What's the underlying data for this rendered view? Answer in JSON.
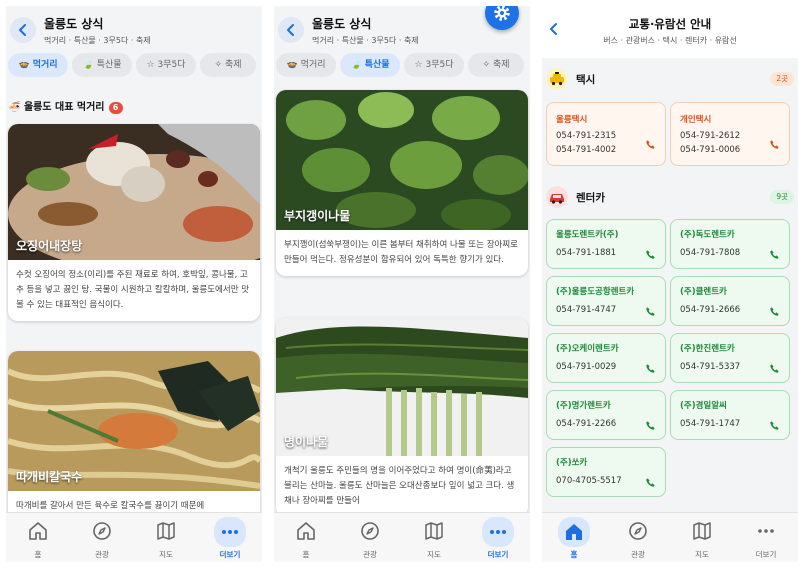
{
  "food": {
    "header": {
      "title": "울릉도 상식",
      "subtitle": "먹거리 · 특산물 · 3무5다 · 축제"
    },
    "tabs": [
      {
        "label": "먹거리"
      },
      {
        "label": "특산물"
      },
      {
        "label": "3무5다"
      },
      {
        "label": "축제"
      }
    ],
    "section": {
      "title": "울릉도 대표 먹거리",
      "count": "6"
    },
    "cards": [
      {
        "title": "오징어내장탕",
        "desc": "수컷 오징어의 정소(이리)를 주된 재료로 하여, 호박잎, 콩나물, 고추 등을 넣고 끓인 탕. 국물이 시원하고 칼칼하며, 울릉도에서만 맛볼 수 있는 대표적인 음식이다."
      },
      {
        "title": "따개비칼국수",
        "desc": "따개비를 갈아서 만든 육수로 칼국수를 끓이기 때문에"
      }
    ],
    "nav": [
      {
        "label": "홈"
      },
      {
        "label": "관광"
      },
      {
        "label": "지도"
      },
      {
        "label": "더보기"
      }
    ]
  },
  "specialty": {
    "header": {
      "title": "울릉도 상식",
      "subtitle": "먹거리 · 특산물 · 3무5다 · 축제"
    },
    "tabs": [
      {
        "label": "먹거리"
      },
      {
        "label": "특산물"
      },
      {
        "label": "3무5다"
      },
      {
        "label": "축제"
      }
    ],
    "cards": [
      {
        "title": "부지갱이나물",
        "desc": "부지깽이(섬쑥부쟁이)는 이른 봄부터 채취하여 나물 또는 장아찌로 만들어 먹는다. 정유성분이 함유되어 있어 독특한 향기가 있다."
      },
      {
        "title": "명이나물",
        "desc": "개척기 울릉도 주민들의 명을 이어주었다고 하여 명이(命荑)라고 불리는 산마늘. 울릉도 산마늘은 오대산종보다 잎이 넓고 크다. 생채나 장아찌를 만들어"
      }
    ],
    "nav": [
      {
        "label": "홈"
      },
      {
        "label": "관광"
      },
      {
        "label": "지도"
      },
      {
        "label": "더보기"
      }
    ]
  },
  "transport": {
    "header": {
      "title": "교통·유람선 안내",
      "subtitle": "버스 · 관광버스 · 택시 · 렌터카 · 유람선"
    },
    "taxi": {
      "name": "택시",
      "count": "2곳",
      "items": [
        {
          "name": "울릉택시",
          "phones": [
            "054-791-2315",
            "054-791-4002"
          ]
        },
        {
          "name": "개인택시",
          "phones": [
            "054-791-2612",
            "054-791-0006"
          ]
        }
      ]
    },
    "rental": {
      "name": "렌터카",
      "count": "9곳",
      "items": [
        {
          "name": "울릉도렌트카(주)",
          "phone": "054-791-1881"
        },
        {
          "name": "(주)독도렌트카",
          "phone": "054-791-7808"
        },
        {
          "name": "(주)울릉도공항렌트카",
          "phone": "054-791-4747"
        },
        {
          "name": "(주)클렌트카",
          "phone": "054-791-2666"
        },
        {
          "name": "(주)오케이렌트카",
          "phone": "054-791-0029"
        },
        {
          "name": "(주)한진렌트카",
          "phone": "054-791-5337"
        },
        {
          "name": "(주)명가렌트카",
          "phone": "054-791-2266"
        },
        {
          "name": "(주)경일알씨",
          "phone": "054-791-1747"
        },
        {
          "name": "(주)쏘카",
          "phone": "070-4705-5517"
        }
      ]
    },
    "nav": [
      {
        "label": "홈"
      },
      {
        "label": "관광"
      },
      {
        "label": "지도"
      },
      {
        "label": "더보기"
      }
    ]
  }
}
